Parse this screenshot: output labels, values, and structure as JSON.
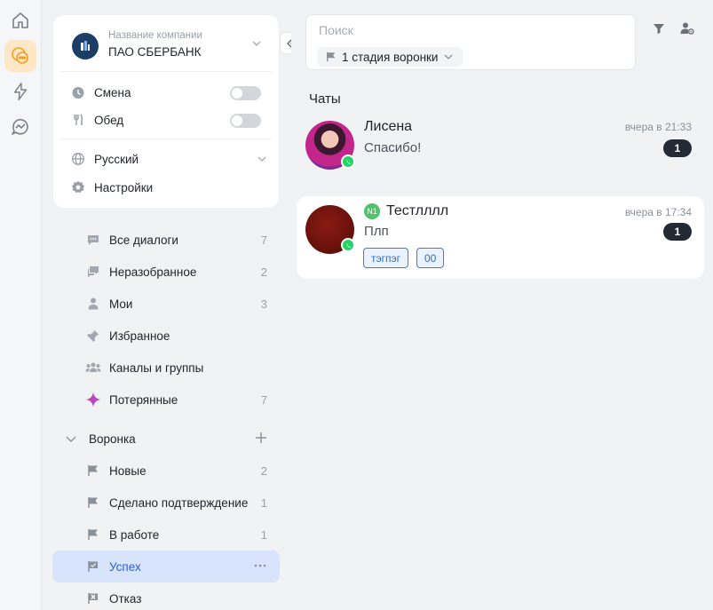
{
  "colors": {
    "accent": "#2c5ed6",
    "active_nav_bg": "#d7e4fc",
    "rail_active_bg": "#fde7c6",
    "rail_active_icon": "#f0a020",
    "whatsapp": "#25d366",
    "unread_bg": "#242a33",
    "tag_border": "#3b7ddd",
    "lost_icon": "#b14bd6"
  },
  "rail": {
    "items": [
      {
        "icon": "home-icon"
      },
      {
        "icon": "chat-bubbles-icon",
        "active": true
      },
      {
        "icon": "lightning-icon"
      },
      {
        "icon": "pulse-chat-icon"
      }
    ]
  },
  "company": {
    "label": "Название компании",
    "name": "ПАО СБЕРБАНК"
  },
  "toggles": {
    "shift_label": "Смена",
    "lunch_label": "Обед"
  },
  "settings": {
    "language": "Русский",
    "settings_label": "Настройки"
  },
  "nav": [
    {
      "label": "Все диалоги",
      "count": "7",
      "icon": "chat-bubble-icon"
    },
    {
      "label": "Неразобранное",
      "count": "2",
      "icon": "chats-icon"
    },
    {
      "label": "Мои",
      "count": "3",
      "icon": "person-icon"
    },
    {
      "label": "Избранное",
      "count": "",
      "icon": "pin-icon"
    },
    {
      "label": "Каналы и группы",
      "count": "",
      "icon": "group-icon"
    },
    {
      "label": "Потерянные",
      "count": "7",
      "icon": "lost-star-icon"
    }
  ],
  "funnel": {
    "title": "Воронка",
    "items": [
      {
        "label": "Новые",
        "count": "2",
        "icon": "flag-icon"
      },
      {
        "label": "Сделано подтверждение",
        "count": "1",
        "icon": "flag-icon"
      },
      {
        "label": "В работе",
        "count": "1",
        "icon": "flag-icon"
      },
      {
        "label": "Успех",
        "count": "",
        "icon": "flag-check-icon",
        "active": true
      },
      {
        "label": "Отказ",
        "count": "",
        "icon": "flag-x-icon"
      }
    ]
  },
  "search": {
    "placeholder": "Поиск",
    "stage_filter": "1 стадия воронки"
  },
  "chats": {
    "title": "Чаты",
    "items": [
      {
        "name": "Лисена",
        "message": "Спасибо!",
        "time": "вчера в 21:33",
        "unread": "1",
        "tags": []
      },
      {
        "name": "Тестлллл",
        "message": "Плп",
        "time": "вчера в 17:34",
        "unread": "1",
        "prefix": "N1",
        "tags": [
          "тэгпэг",
          "00"
        ]
      }
    ]
  }
}
